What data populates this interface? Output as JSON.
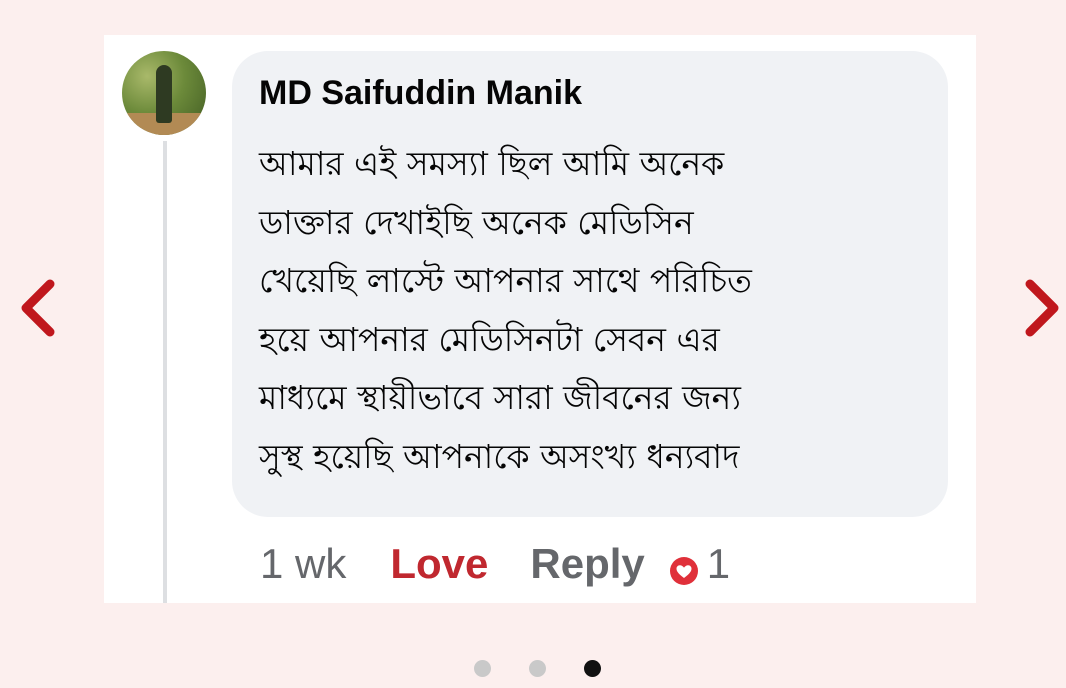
{
  "comment": {
    "author": "MD Saifuddin Manik",
    "text_lines": [
      "আমার এই সমস্যা ছিল আমি অনেক",
      "ডাক্তার দেখাইছি অনেক মেডিসিন",
      "খেয়েছি  লাস্টে আপনার সাথে পরিচিত",
      "হয়ে আপনার মেডিসিনটা সেবন এর",
      "মাধ্যমে স্থায়ীভাবে সারা জীবনের জন্য",
      "সুস্থ হয়েছি আপনাকে অসংখ্য ধন্যবাদ"
    ],
    "timestamp": "1 wk",
    "love_label": "Love",
    "reply_label": "Reply",
    "reaction_count": "1",
    "reaction_icon": "heart-icon"
  },
  "carousel": {
    "total_slides": 3,
    "active_slide": 3,
    "prev_icon": "chevron-left-icon",
    "next_icon": "chevron-right-icon"
  },
  "colors": {
    "page_background": "#fcefee",
    "bubble_background": "#f0f2f5",
    "love_text": "#c0282f",
    "arrow": "#c0171d",
    "heart_badge": "#e0303a",
    "muted_text": "#65676b"
  }
}
